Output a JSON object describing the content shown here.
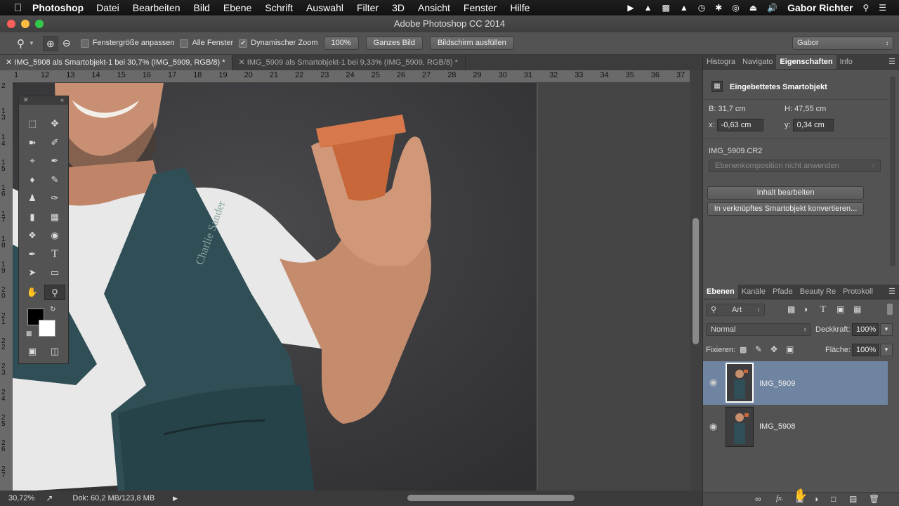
{
  "menubar": {
    "apple": "",
    "app": "Photoshop",
    "items": [
      "Datei",
      "Bearbeiten",
      "Bild",
      "Ebene",
      "Schrift",
      "Auswahl",
      "Filter",
      "3D",
      "Ansicht",
      "Fenster",
      "Hilfe"
    ],
    "user": "Gabor Richter"
  },
  "window": {
    "title": "Adobe Photoshop CC 2014"
  },
  "options": {
    "fit_window": "Fenstergröße anpassen",
    "all_windows": "Alle Fenster",
    "dynamic_zoom": "Dynamischer Zoom",
    "zoom_100": "100%",
    "whole_image": "Ganzes Bild",
    "fill_screen": "Bildschirm ausfüllen",
    "workspace": "Gabor"
  },
  "tabs": [
    {
      "label": "IMG_5908 als Smartobjekt-1 bei 30,7% (IMG_5909, RGB/8) *"
    },
    {
      "label": "IMG_5909 als Smartobjekt-1 bei 9,33% (IMG_5909, RGB/8) *"
    }
  ],
  "ruler": {
    "h": [
      "1",
      "12",
      "13",
      "14",
      "15",
      "16",
      "17",
      "18",
      "19",
      "20",
      "21",
      "22",
      "23",
      "24",
      "25",
      "26",
      "27",
      "28",
      "29",
      "30",
      "31",
      "32",
      "33",
      "34",
      "35",
      "36",
      "37"
    ],
    "v": [
      "2",
      "1 3",
      "1 4",
      "1 5",
      "1 6",
      "1 7",
      "1 8",
      "1 9",
      "2 0",
      "2 1",
      "2 2",
      "2 3",
      "2 4",
      "2 5",
      "2 6",
      "2 7",
      "2 8"
    ]
  },
  "status": {
    "zoom": "30,72%",
    "doc": "Dok: 60,2 MB/123,8 MB"
  },
  "properties": {
    "tabs": [
      "Histogra",
      "Navigato",
      "Eigenschaften",
      "Info"
    ],
    "type": "Eingebettetes Smartobjekt",
    "w_label": "B:",
    "w_value": "31,7 cm",
    "h_label": "H:",
    "h_value": "47,55 cm",
    "x_label": "x:",
    "x_value": "-0,63 cm",
    "y_label": "y:",
    "y_value": "0,34 cm",
    "file": "IMG_5909.CR2",
    "comp": "Ebenenkomposition nicht anwenden",
    "edit_btn": "Inhalt bearbeiten",
    "convert_btn": "In verknüpftes Smartobjekt konvertieren..."
  },
  "layers": {
    "tabs": [
      "Ebenen",
      "Kanäle",
      "Pfade",
      "Beauty Re",
      "Protokoll"
    ],
    "filter": "Art",
    "blend": "Normal",
    "opacity_label": "Deckkraft:",
    "opacity": "100%",
    "lock_label": "Fixieren:",
    "fill_label": "Fläche:",
    "fill": "100%",
    "items": [
      {
        "name": "IMG_5909"
      },
      {
        "name": "IMG_5908"
      }
    ]
  },
  "colors": {
    "accent_selected_layer": "#6f84a0",
    "canvas_bg": "#3d3c3f",
    "panel": "#535353"
  }
}
